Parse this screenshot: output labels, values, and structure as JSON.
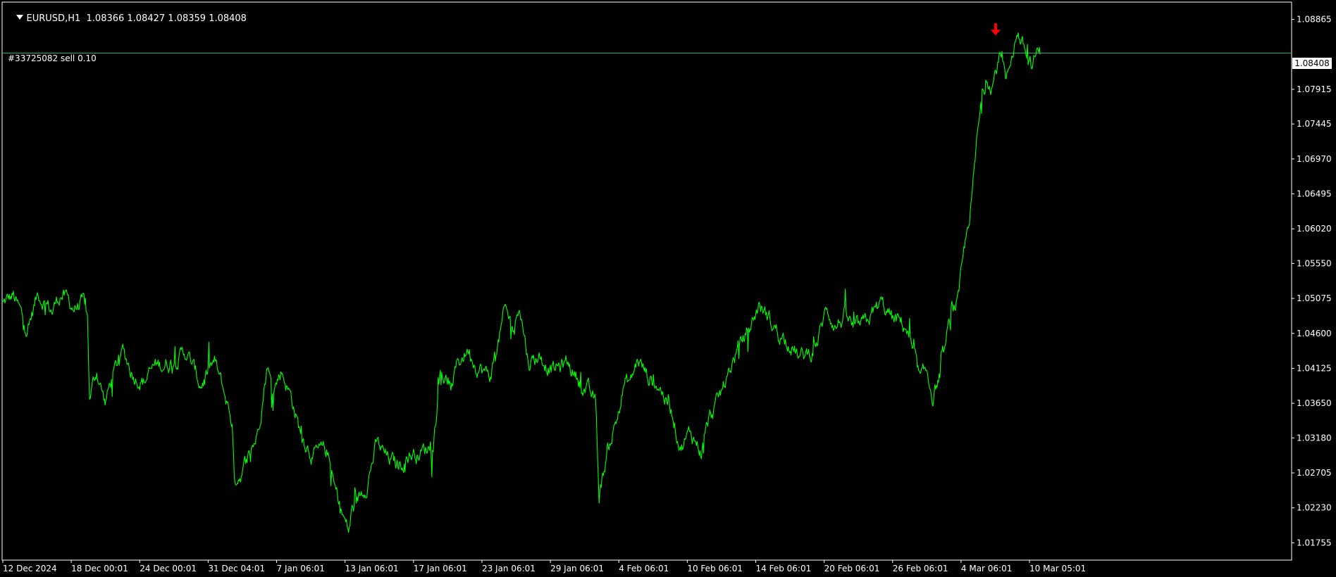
{
  "header": {
    "symbol": "EURUSD,H1",
    "ohlc": "1.08366 1.08427 1.08359 1.08408"
  },
  "order": {
    "label": "#33725082 sell 0.10",
    "price": 1.08408,
    "price_label": "1.08408"
  },
  "colors": {
    "background": "#000000",
    "price_line": "#00ff00",
    "order_line": "#3cb371",
    "sell_arrow": "#ff0000",
    "axis": "#ffffff",
    "price_tag_bg": "#ffffff"
  },
  "chart_data": {
    "type": "line",
    "title": "EURUSD,H1",
    "ylim": [
      1.0152,
      1.091
    ],
    "yticks": [
      1.08865,
      1.07915,
      1.07445,
      1.0697,
      1.06495,
      1.0602,
      1.0555,
      1.05075,
      1.046,
      1.04125,
      1.0365,
      1.0318,
      1.02705,
      1.0223,
      1.01755
    ],
    "ytick_labels": [
      "1.08865",
      "1.07915",
      "1.07445",
      "1.06970",
      "1.06495",
      "1.06020",
      "1.05550",
      "1.05075",
      "1.04600",
      "1.04125",
      "1.03650",
      "1.03180",
      "1.02705",
      "1.02230",
      "1.01755"
    ],
    "xtick_labels": [
      "12 Dec 2024",
      "18 Dec 00:01",
      "24 Dec 00:01",
      "31 Dec 04:01",
      "7 Jan 06:01",
      "13 Jan 06:01",
      "17 Jan 06:01",
      "23 Jan 06:01",
      "29 Jan 06:01",
      "4 Feb 06:01",
      "10 Feb 06:01",
      "14 Feb 06:01",
      "20 Feb 06:01",
      "26 Feb 06:01",
      "4 Mar 06:01",
      "10 Mar 05:01"
    ],
    "xtick_index": [
      0,
      97,
      194,
      291,
      388,
      485,
      582,
      679,
      776,
      873,
      970,
      1067,
      1164,
      1261,
      1358,
      1455
    ],
    "x_count": 1470,
    "series": [
      {
        "anchors": [
          [
            0,
            1.05
          ],
          [
            15,
            1.051
          ],
          [
            35,
            1.0465
          ],
          [
            50,
            1.0515
          ],
          [
            70,
            1.049
          ],
          [
            82,
            1.0515
          ],
          [
            100,
            1.0495
          ],
          [
            115,
            1.05
          ],
          [
            120,
            1.048
          ],
          [
            123,
            1.037
          ],
          [
            133,
            1.041
          ],
          [
            145,
            1.0365
          ],
          [
            155,
            1.04
          ],
          [
            170,
            1.0435
          ],
          [
            185,
            1.0405
          ],
          [
            200,
            1.0395
          ],
          [
            215,
            1.0415
          ],
          [
            235,
            1.042
          ],
          [
            260,
            1.0435
          ],
          [
            280,
            1.039
          ],
          [
            300,
            1.042
          ],
          [
            315,
            1.0375
          ],
          [
            325,
            1.034
          ],
          [
            328,
            1.026
          ],
          [
            340,
            1.0275
          ],
          [
            360,
            1.032
          ],
          [
            375,
            1.042
          ],
          [
            382,
            1.038
          ],
          [
            395,
            1.041
          ],
          [
            410,
            1.037
          ],
          [
            420,
            1.033
          ],
          [
            440,
            1.0295
          ],
          [
            460,
            1.03
          ],
          [
            470,
            1.025
          ],
          [
            480,
            1.022
          ],
          [
            490,
            1.019
          ],
          [
            495,
            1.022
          ],
          [
            515,
            1.0255
          ],
          [
            530,
            1.031
          ],
          [
            545,
            1.029
          ],
          [
            560,
            1.028
          ],
          [
            575,
            1.0295
          ],
          [
            595,
            1.03
          ],
          [
            610,
            1.031
          ],
          [
            620,
            1.041
          ],
          [
            635,
            1.0385
          ],
          [
            645,
            1.042
          ],
          [
            660,
            1.044
          ],
          [
            670,
            1.042
          ],
          [
            690,
            1.04
          ],
          [
            700,
            1.044
          ],
          [
            712,
            1.049
          ],
          [
            725,
            1.0465
          ],
          [
            732,
            1.0505
          ],
          [
            745,
            1.042
          ],
          [
            760,
            1.043
          ],
          [
            780,
            1.041
          ],
          [
            800,
            1.042
          ],
          [
            815,
            1.04
          ],
          [
            830,
            1.038
          ],
          [
            840,
            1.0365
          ],
          [
            845,
            1.024
          ],
          [
            858,
            1.0305
          ],
          [
            872,
            1.035
          ],
          [
            880,
            1.039
          ],
          [
            890,
            1.0395
          ],
          [
            900,
            1.0425
          ],
          [
            915,
            1.04
          ],
          [
            930,
            1.039
          ],
          [
            950,
            1.035
          ],
          [
            960,
            1.0305
          ],
          [
            975,
            1.0325
          ],
          [
            990,
            1.03
          ],
          [
            1000,
            1.034
          ],
          [
            1015,
            1.037
          ],
          [
            1030,
            1.041
          ],
          [
            1045,
            1.0445
          ],
          [
            1060,
            1.047
          ],
          [
            1072,
            1.05
          ],
          [
            1085,
            1.048
          ],
          [
            1100,
            1.046
          ],
          [
            1115,
            1.045
          ],
          [
            1130,
            1.0425
          ],
          [
            1145,
            1.0435
          ],
          [
            1155,
            1.045
          ],
          [
            1168,
            1.0495
          ],
          [
            1180,
            1.047
          ],
          [
            1195,
            1.0485
          ],
          [
            1205,
            1.0465
          ],
          [
            1220,
            1.047
          ],
          [
            1235,
            1.049
          ],
          [
            1245,
            1.05
          ],
          [
            1260,
            1.048
          ],
          [
            1280,
            1.047
          ],
          [
            1290,
            1.043
          ],
          [
            1300,
            1.0395
          ],
          [
            1310,
            1.0405
          ],
          [
            1318,
            1.0375
          ],
          [
            1325,
            1.0395
          ],
          [
            1335,
            1.0435
          ],
          [
            1345,
            1.049
          ],
          [
            1355,
            1.0505
          ],
          [
            1360,
            1.055
          ],
          [
            1367,
            1.06
          ],
          [
            1374,
            1.065
          ],
          [
            1380,
            1.0715
          ],
          [
            1387,
            1.0775
          ],
          [
            1395,
            1.0805
          ],
          [
            1402,
            1.08
          ],
          [
            1410,
            1.0825
          ],
          [
            1416,
            1.0845
          ],
          [
            1422,
            1.08
          ],
          [
            1430,
            1.084
          ],
          [
            1438,
            1.087
          ],
          [
            1446,
            1.085
          ],
          [
            1452,
            1.0835
          ],
          [
            1458,
            1.082
          ],
          [
            1465,
            1.084
          ],
          [
            1470,
            1.0841
          ]
        ]
      }
    ],
    "sell_marker_index": 1407
  }
}
